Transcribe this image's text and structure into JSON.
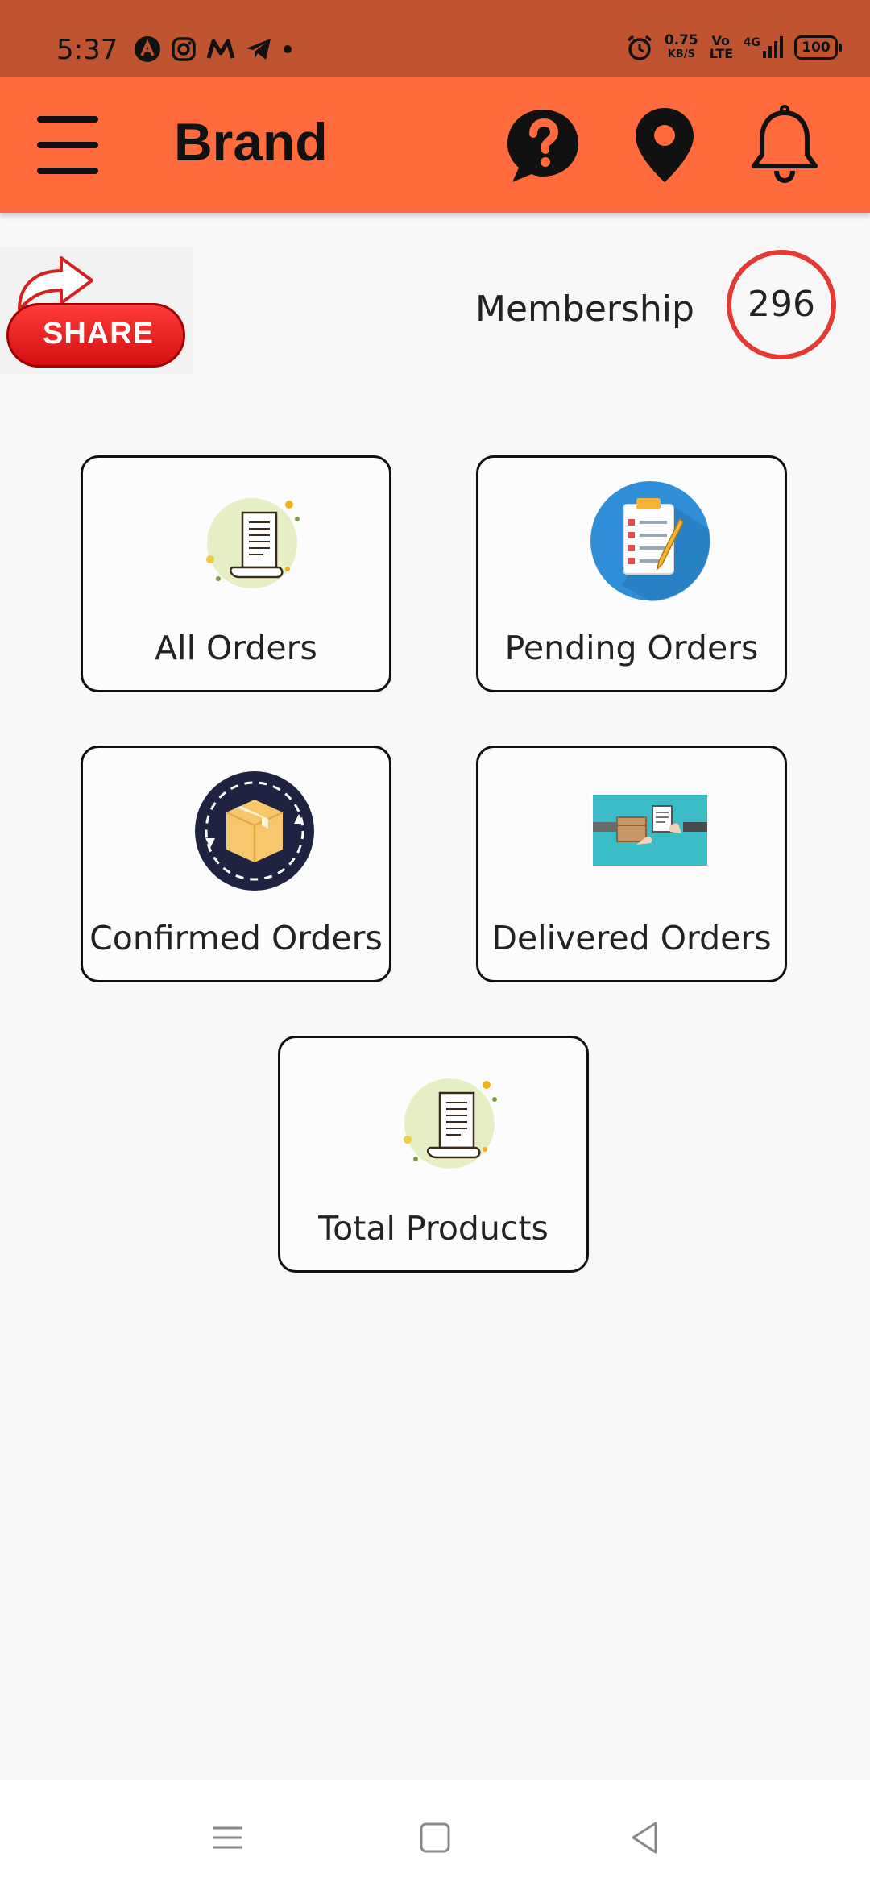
{
  "status_bar": {
    "time": "5:37",
    "left_icons": [
      "app-a-icon",
      "instagram-icon",
      "m-app-icon",
      "telegram-icon",
      "dot-icon"
    ],
    "net_speed": "0.75",
    "net_unit": "KB/S",
    "volte": "Vo LTE",
    "network": "4G",
    "battery": "100"
  },
  "app_bar": {
    "title": "Brand",
    "icons": [
      "menu-icon",
      "help-icon",
      "location-icon",
      "bell-icon"
    ],
    "color": "#ff6b3d"
  },
  "share": {
    "label": "SHARE"
  },
  "membership": {
    "label": "Membership",
    "count": "296",
    "ring_color": "#e53935"
  },
  "cards": [
    {
      "label": "All Orders",
      "icon": "receipt-icon"
    },
    {
      "label": "Pending Orders",
      "icon": "clipboard-icon"
    },
    {
      "label": "Confirmed Orders",
      "icon": "box-icon"
    },
    {
      "label": "Delivered Orders",
      "icon": "delivery-handover-icon"
    },
    {
      "label": "Total Products",
      "icon": "receipt-icon"
    }
  ],
  "nav_bar": {
    "icons": [
      "recent-apps-icon",
      "home-icon",
      "back-icon"
    ]
  }
}
